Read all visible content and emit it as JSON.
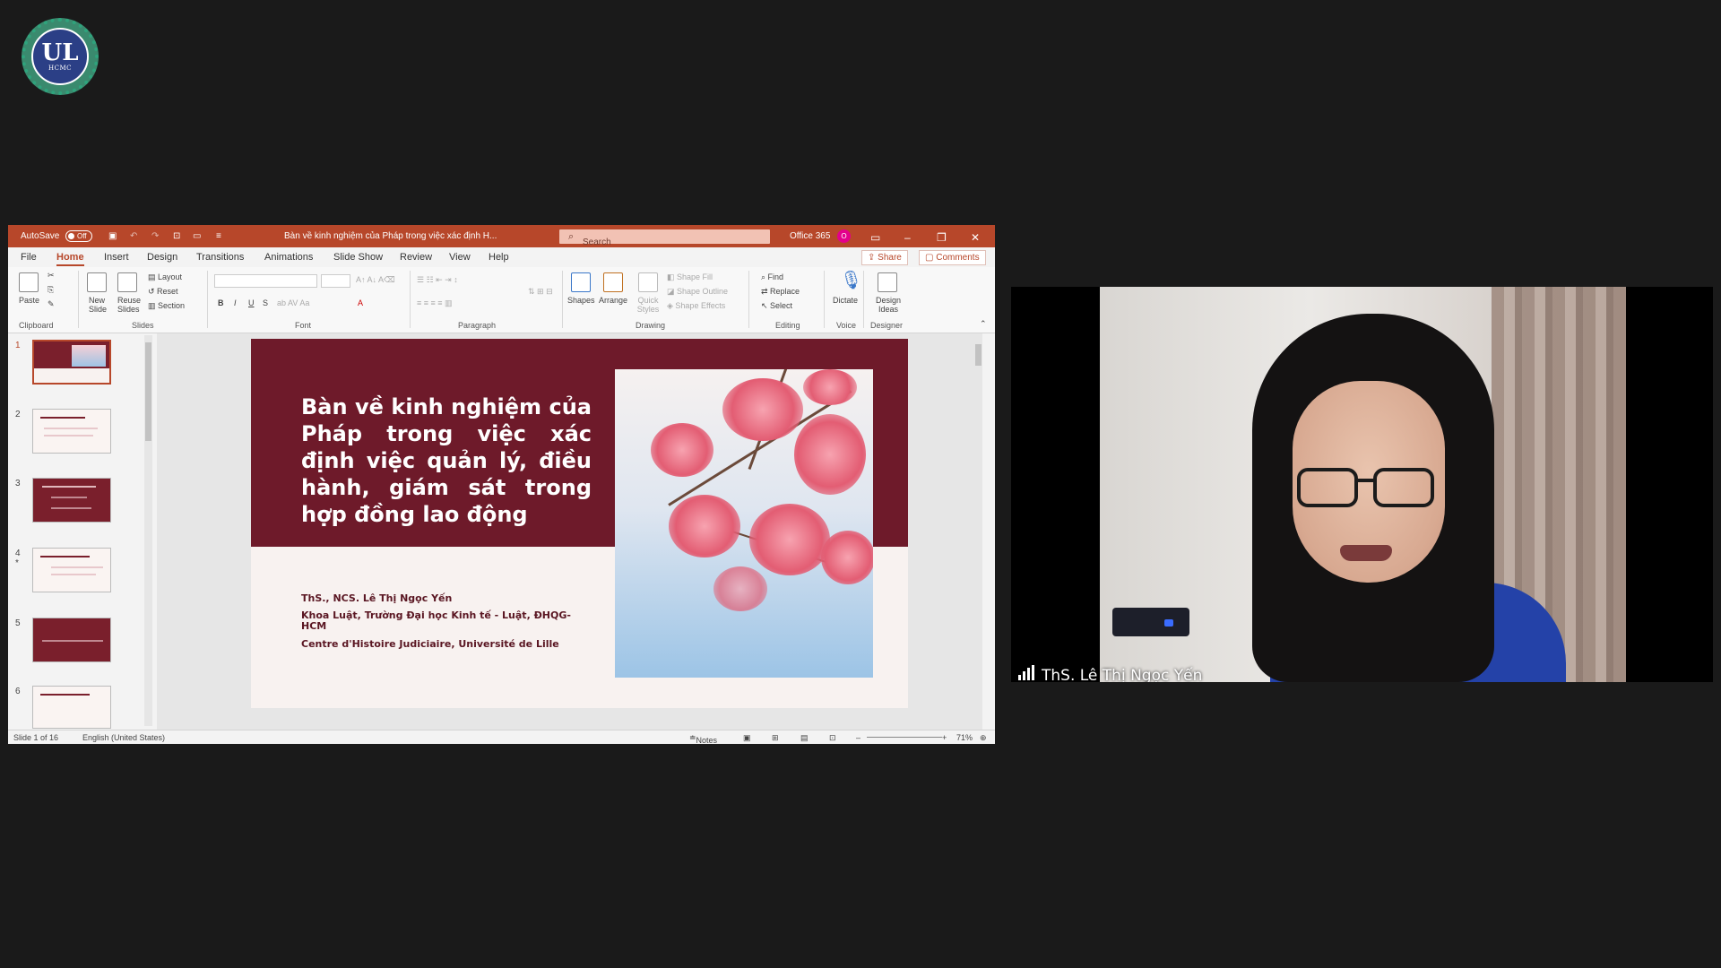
{
  "logo": {
    "monogram": "UL",
    "text": "HCMC"
  },
  "powerpoint": {
    "titlebar": {
      "autosave_label": "AutoSave",
      "autosave_state": "Off",
      "document_title": "Bàn về kinh nghiệm của Pháp trong việc xác định H...",
      "search_placeholder": "Search",
      "account_label": "Office 365",
      "avatar_initial": "O"
    },
    "menu": [
      "File",
      "Home",
      "Insert",
      "Design",
      "Transitions",
      "Animations",
      "Slide Show",
      "Review",
      "View",
      "Help"
    ],
    "active_tab": "Home",
    "share_label": "Share",
    "comments_label": "Comments",
    "ribbon": {
      "paste": "Paste",
      "new_slide": "New Slide",
      "reuse_slides": "Reuse Slides",
      "layout": "Layout",
      "reset": "Reset",
      "section": "Section",
      "shapes": "Shapes",
      "arrange": "Arrange",
      "quick_styles": "Quick Styles",
      "shape_fill": "Shape Fill",
      "shape_outline": "Shape Outline",
      "shape_effects": "Shape Effects",
      "find": "Find",
      "replace": "Replace",
      "select": "Select",
      "dictate": "Dictate",
      "design_ideas": "Design Ideas",
      "groups": [
        "Clipboard",
        "Slides",
        "Font",
        "Paragraph",
        "Drawing",
        "Editing",
        "Voice",
        "Designer"
      ]
    },
    "thumbnails": [
      "1",
      "2",
      "3",
      "4",
      "5",
      "6"
    ],
    "slide": {
      "title": "Bàn về kinh nghiệm của Pháp trong việc xác định việc quản lý, điều hành, giám sát trong hợp đồng lao động",
      "author": "ThS., NCS. Lê Thị Ngọc Yến",
      "affiliation1": "Khoa Luật, Trường Đại học Kinh tế - Luật, ĐHQG-HCM",
      "affiliation2": "Centre d'Histoire Judiciaire, Université de Lille"
    },
    "statusbar": {
      "slide_count": "Slide 1 of 16",
      "language": "English (United States)",
      "notes": "Notes",
      "zoom": "71%"
    }
  },
  "video": {
    "participant_name": "ThS. Lê Thị Ngọc Yến"
  },
  "colors": {
    "ppt_accent": "#b7472a",
    "slide_maroon": "#6e1a2a"
  }
}
